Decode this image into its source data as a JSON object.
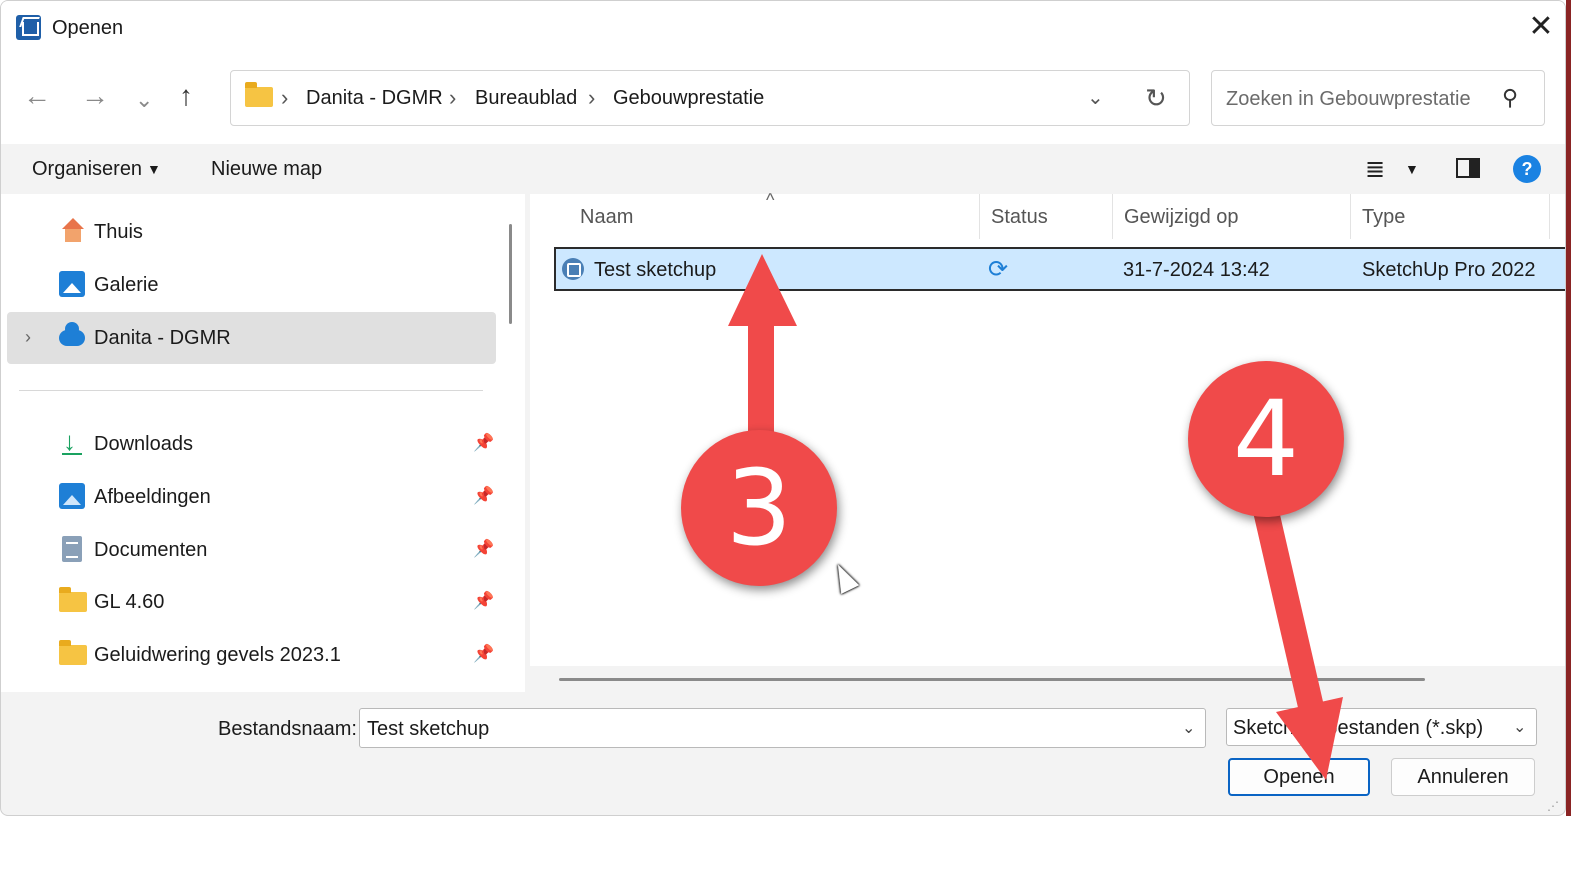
{
  "window": {
    "title": "Openen",
    "close_glyph": "✕"
  },
  "nav": {
    "back_glyph": "←",
    "forward_glyph": "→",
    "recent_glyph": "⌄",
    "up_glyph": "↑"
  },
  "address": {
    "crumbs": [
      "Danita - DGMR",
      "Bureaublad",
      "Gebouwprestatie"
    ],
    "separator": "›",
    "dropdown_glyph": "⌄",
    "refresh_glyph": "↻"
  },
  "search": {
    "placeholder": "Zoeken in Gebouwprestatie",
    "icon_glyph": "⚲"
  },
  "commandbar": {
    "organize_label": "Organiseren",
    "caret": "▼",
    "new_folder_label": "Nieuwe map",
    "view_glyph": "≣",
    "help_glyph": "?"
  },
  "sidebar": {
    "expander_glyph": "›",
    "pin_glyph": "📌",
    "items": [
      {
        "label": "Thuis",
        "icon": "home-icon"
      },
      {
        "label": "Galerie",
        "icon": "gallery-icon"
      },
      {
        "label": "Danita - DGMR",
        "icon": "onedrive-cloud-icon",
        "selected": true
      },
      {
        "label": "Downloads",
        "icon": "download-icon",
        "pinned": true
      },
      {
        "label": "Afbeeldingen",
        "icon": "pictures-icon",
        "pinned": true
      },
      {
        "label": "Documenten",
        "icon": "documents-icon",
        "pinned": true
      },
      {
        "label": "GL 4.60",
        "icon": "folder-icon",
        "pinned": true
      },
      {
        "label": "Geluidwering gevels 2023.1",
        "icon": "folder-icon",
        "pinned": true
      }
    ]
  },
  "filelist": {
    "sort_glyph": "^",
    "columns": [
      "Naam",
      "Status",
      "Gewijzigd op",
      "Type"
    ],
    "rows": [
      {
        "name": "Test sketchup",
        "status_icon": "sync-icon",
        "status_glyph": "⟳",
        "modified": "31-7-2024 13:42",
        "type": "SketchUp Pro 2022",
        "selected": true
      }
    ]
  },
  "footer": {
    "filename_label": "Bestandsnaam:",
    "filename_value": "Test sketchup",
    "dropdown_glyph": "⌄",
    "filetype_value": "SketchUp-bestanden (*.skp)",
    "open_label": "Openen",
    "cancel_label": "Annuleren",
    "grip_glyph": "⋰"
  },
  "annotations": {
    "step_a": "3",
    "step_b": "4",
    "color": "#f04a4a"
  }
}
